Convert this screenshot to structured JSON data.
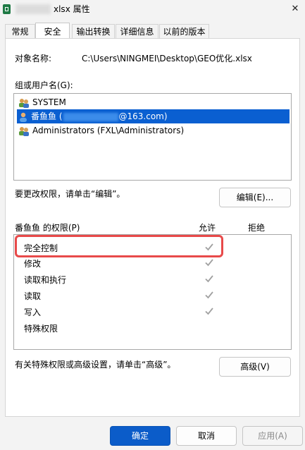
{
  "window": {
    "title": "xlsx 属性",
    "close_glyph": "✕"
  },
  "tabs": [
    {
      "label": "常规"
    },
    {
      "label": "安全"
    },
    {
      "label": "输出转换"
    },
    {
      "label": "详细信息"
    },
    {
      "label": "以前的版本"
    }
  ],
  "security": {
    "object_label": "对象名称:",
    "object_value": "C:\\Users\\NINGMEI\\Desktop\\GEO优化.xlsx",
    "groups_label": "组或用户名(G):",
    "users": [
      {
        "name": "SYSTEM",
        "icon": "users-group-icon"
      },
      {
        "name_prefix": "番鱼鱼 (",
        "name_suffix": "@163.com)",
        "icon": "user-icon",
        "selected": true
      },
      {
        "name": "Administrators (FXL\\Administrators)",
        "icon": "users-group-icon"
      }
    ],
    "edit_hint": "要更改权限，请单击“编辑”。",
    "edit_button": "编辑(E)...",
    "perm_header": "番鱼鱼 的权限(P)",
    "allow_header": "允许",
    "deny_header": "拒绝",
    "permissions": [
      {
        "name": "完全控制",
        "allow": true
      },
      {
        "name": "修改",
        "allow": true
      },
      {
        "name": "读取和执行",
        "allow": true
      },
      {
        "name": "读取",
        "allow": true
      },
      {
        "name": "写入",
        "allow": true
      },
      {
        "name": "特殊权限",
        "allow": false
      }
    ],
    "advanced_hint": "有关特殊权限或高级设置，请单击“高级”。",
    "advanced_button": "高级(V)"
  },
  "footer": {
    "ok": "确定",
    "cancel": "取消",
    "apply": "应用(A)"
  },
  "colors": {
    "selection": "#0a5fd1",
    "primary": "#0b5cc9",
    "highlight": "#e84a4a",
    "check": "#a0a0a0"
  }
}
